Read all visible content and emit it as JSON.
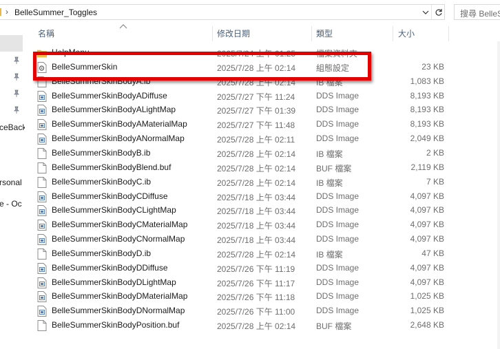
{
  "address_bar": {
    "path": "BelleSummer_Toggles",
    "search_placeholder": "搜尋 BelleS"
  },
  "nav": {
    "items": [
      "ceBack",
      "rsonal",
      "e - Oc"
    ]
  },
  "columns": {
    "name": "名稱",
    "date": "修改日期",
    "type": "類型",
    "size": "大小"
  },
  "files": [
    {
      "name": "HelpMenu",
      "date": "2025/7/24 上午 01:25",
      "type": "檔案資料夾",
      "size": "",
      "icon": "folder-icon"
    },
    {
      "name": "BelleSummerSkin",
      "date": "2025/7/28 上午 02:14",
      "type": "組態設定",
      "size": "23 KB",
      "icon": "settings-file-icon"
    },
    {
      "name": "BelleSummerSkinBodyA.ib",
      "date": "2025/7/28 上午 02:14",
      "type": "IB 檔案",
      "size": "1,083 KB",
      "icon": "file-icon"
    },
    {
      "name": "BelleSummerSkinBodyADiffuse",
      "date": "2025/7/27 下午 11:24",
      "type": "DDS Image",
      "size": "8,193 KB",
      "icon": "image-file-icon"
    },
    {
      "name": "BelleSummerSkinBodyALightMap",
      "date": "2025/7/27 下午 01:39",
      "type": "DDS Image",
      "size": "8,193 KB",
      "icon": "image-file-icon"
    },
    {
      "name": "BelleSummerSkinBodyAMaterialMap",
      "date": "2025/7/27 下午 11:48",
      "type": "DDS Image",
      "size": "8,193 KB",
      "icon": "image-file-icon"
    },
    {
      "name": "BelleSummerSkinBodyANormalMap",
      "date": "2025/7/28 上午 02:11",
      "type": "DDS Image",
      "size": "2,049 KB",
      "icon": "image-file-icon"
    },
    {
      "name": "BelleSummerSkinBodyB.ib",
      "date": "2025/7/28 上午 02:14",
      "type": "IB 檔案",
      "size": "2 KB",
      "icon": "file-icon"
    },
    {
      "name": "BelleSummerSkinBodyBlend.buf",
      "date": "2025/7/28 上午 02:14",
      "type": "BUF 檔案",
      "size": "2,119 KB",
      "icon": "file-icon"
    },
    {
      "name": "BelleSummerSkinBodyC.ib",
      "date": "2025/7/28 上午 02:14",
      "type": "IB 檔案",
      "size": "7 KB",
      "icon": "file-icon"
    },
    {
      "name": "BelleSummerSkinBodyCDiffuse",
      "date": "2025/7/18 上午 03:44",
      "type": "DDS Image",
      "size": "4,097 KB",
      "icon": "image-file-icon"
    },
    {
      "name": "BelleSummerSkinBodyCLightMap",
      "date": "2025/7/18 上午 03:44",
      "type": "DDS Image",
      "size": "4,097 KB",
      "icon": "image-file-icon"
    },
    {
      "name": "BelleSummerSkinBodyCMaterialMap",
      "date": "2025/7/18 上午 03:44",
      "type": "DDS Image",
      "size": "4,097 KB",
      "icon": "image-file-icon"
    },
    {
      "name": "BelleSummerSkinBodyCNormalMap",
      "date": "2025/7/18 上午 03:44",
      "type": "DDS Image",
      "size": "4,097 KB",
      "icon": "image-file-icon"
    },
    {
      "name": "BelleSummerSkinBodyD.ib",
      "date": "2025/7/28 上午 02:14",
      "type": "IB 檔案",
      "size": "47 KB",
      "icon": "file-icon"
    },
    {
      "name": "BelleSummerSkinBodyDDiffuse",
      "date": "2025/7/26 下午 11:19",
      "type": "DDS Image",
      "size": "4,097 KB",
      "icon": "image-file-icon"
    },
    {
      "name": "BelleSummerSkinBodyDLightMap",
      "date": "2025/7/26 下午 11:17",
      "type": "DDS Image",
      "size": "4,097 KB",
      "icon": "image-file-icon"
    },
    {
      "name": "BelleSummerSkinBodyDMaterialMap",
      "date": "2025/7/26 下午 11:18",
      "type": "DDS Image",
      "size": "1,025 KB",
      "icon": "image-file-icon"
    },
    {
      "name": "BelleSummerSkinBodyDNormalMap",
      "date": "2025/7/26 下午 11:00",
      "type": "DDS Image",
      "size": "1,025 KB",
      "icon": "image-file-icon"
    },
    {
      "name": "BelleSummerSkinBodyPosition.buf",
      "date": "2025/7/28 上午 02:14",
      "type": "BUF 檔案",
      "size": "2,648 KB",
      "icon": "file-icon"
    }
  ],
  "highlight": {
    "color": "#e30000",
    "file": "BelleSummerSkin"
  }
}
